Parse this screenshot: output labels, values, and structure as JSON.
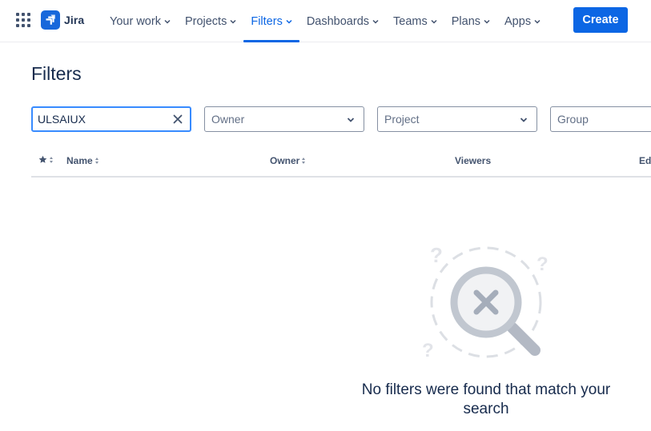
{
  "topnav": {
    "logo_text": "Jira",
    "items": [
      {
        "label": "Your work",
        "active": false
      },
      {
        "label": "Projects",
        "active": false
      },
      {
        "label": "Filters",
        "active": true
      },
      {
        "label": "Dashboards",
        "active": false
      },
      {
        "label": "Teams",
        "active": false
      },
      {
        "label": "Plans",
        "active": false
      },
      {
        "label": "Apps",
        "active": false
      }
    ],
    "create_label": "Create"
  },
  "page": {
    "title": "Filters"
  },
  "filters": {
    "search_value": "ULSAIUX",
    "owner_placeholder": "Owner",
    "project_placeholder": "Project",
    "group_placeholder": "Group"
  },
  "table": {
    "columns": {
      "name": "Name",
      "owner": "Owner",
      "viewers": "Viewers",
      "edit": "Ed"
    }
  },
  "empty_state": {
    "message": "No filters were found that match your search"
  },
  "colors": {
    "brand": "#0c66e4",
    "text": "#172b4d",
    "muted": "#626f86"
  },
  "icons": {
    "apps": "app-switcher-icon",
    "logo": "jira-logo-icon",
    "clear": "close-icon",
    "chevron": "chevron-down-icon",
    "star": "star-icon",
    "sort": "sort-icon"
  }
}
